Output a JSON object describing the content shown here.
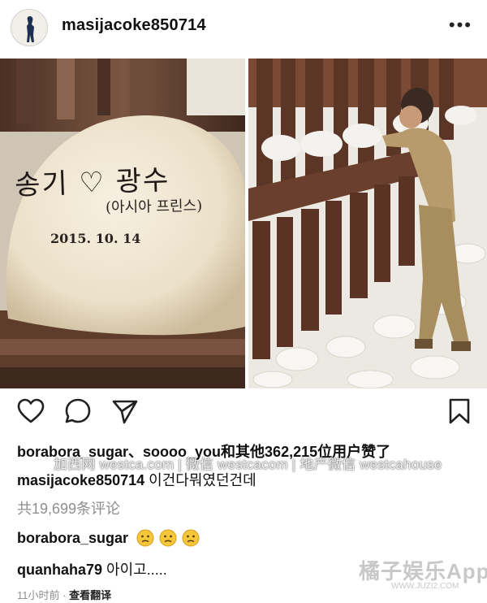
{
  "post": {
    "username": "masijacoke850714",
    "more_icon": "more-horizontal-icon"
  },
  "photos": {
    "left_stone_text": {
      "line1": "송기 ♡ 광수",
      "line2": "(아시아 프린스)",
      "date": "2015. 10. 14"
    }
  },
  "actions": {
    "like_icon": "heart-outline-icon",
    "comment_icon": "comment-bubble-icon",
    "share_icon": "paper-plane-icon",
    "save_icon": "bookmark-icon"
  },
  "likes": {
    "text": "borabora_sugar、soooo_you和其他362,215位用户赞了"
  },
  "caption": {
    "username": "masijacoke850714",
    "text": "이건다뭐였던건데"
  },
  "comments_count": "共19,699条评论",
  "comments": [
    {
      "username": "borabora_sugar",
      "text": "",
      "emojis": [
        "confused-face-emoji",
        "confused-face-emoji",
        "confused-face-emoji"
      ]
    },
    {
      "username": "quanhaha79",
      "text": "아이고....."
    }
  ],
  "meta": {
    "time": "11小时前",
    "separator": "·",
    "translate": "查看翻译"
  },
  "watermarks": {
    "center": "加西网 westca.com | 微信 westcacom | 地产微信 westcahouse",
    "logo": "橘子娱乐App",
    "url": "WWW.JUZI2.COM"
  },
  "colors": {
    "text": "#111111",
    "secondary": "#8e8e8e",
    "stone": "#efe6d3",
    "rust": "#6b4633"
  }
}
